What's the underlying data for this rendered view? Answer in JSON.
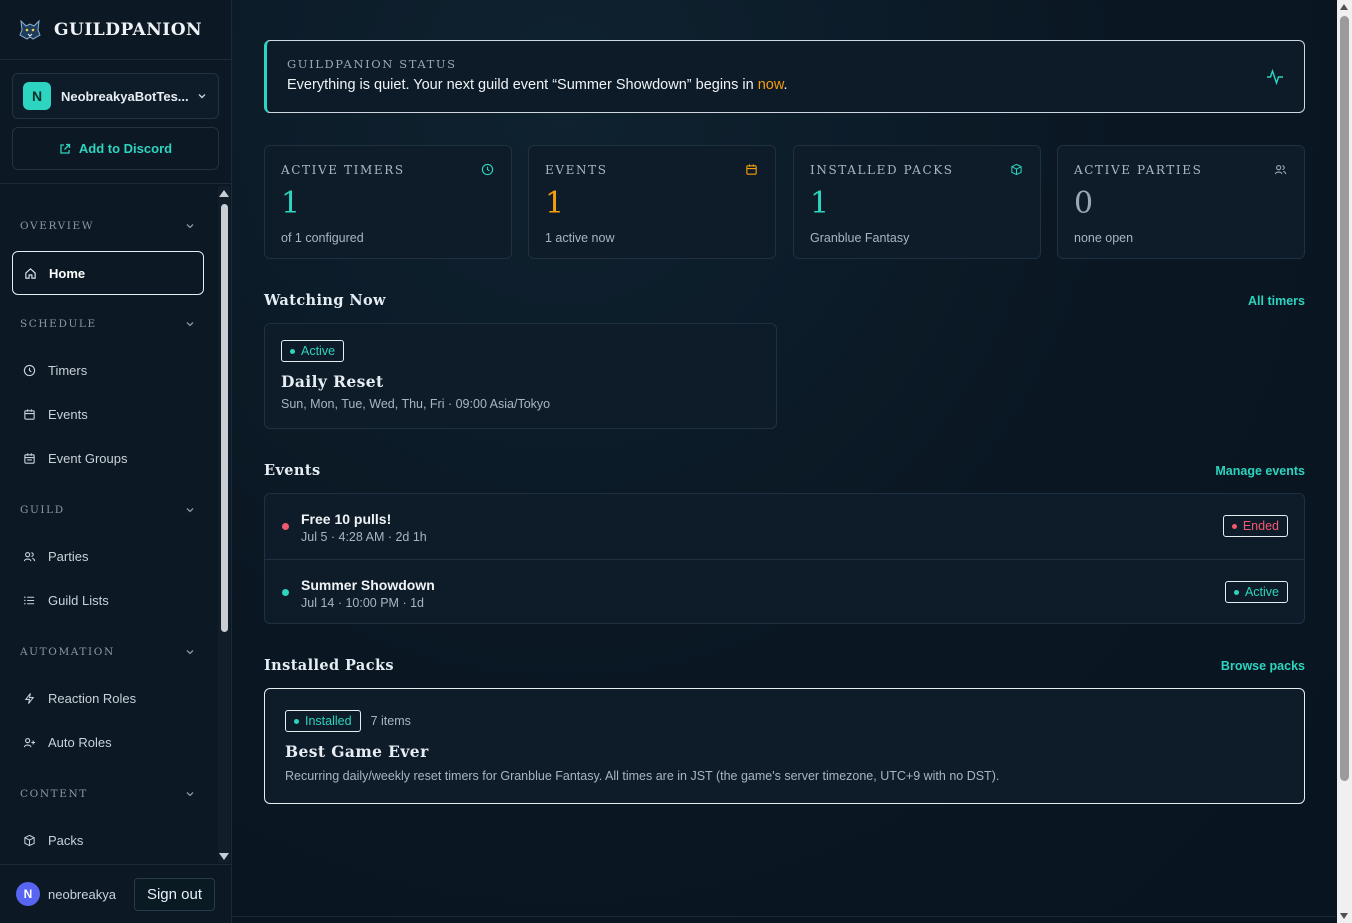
{
  "app": {
    "name": "GUILDPANION"
  },
  "server": {
    "initial": "N",
    "name": "NeobreakyaBotTes..."
  },
  "add_discord": {
    "label": "Add to Discord"
  },
  "sidebar": {
    "sections": [
      {
        "title": "OVERVIEW",
        "items": [
          {
            "label": "Home",
            "icon": "home-icon",
            "active": true
          }
        ]
      },
      {
        "title": "SCHEDULE",
        "items": [
          {
            "label": "Timers",
            "icon": "clock-icon"
          },
          {
            "label": "Events",
            "icon": "calendar-icon"
          },
          {
            "label": "Event Groups",
            "icon": "calendar-group-icon"
          }
        ]
      },
      {
        "title": "GUILD",
        "items": [
          {
            "label": "Parties",
            "icon": "users-icon"
          },
          {
            "label": "Guild Lists",
            "icon": "list-icon"
          }
        ]
      },
      {
        "title": "AUTOMATION",
        "items": [
          {
            "label": "Reaction Roles",
            "icon": "bolt-icon"
          },
          {
            "label": "Auto Roles",
            "icon": "user-plus-icon"
          }
        ]
      },
      {
        "title": "CONTENT",
        "items": [
          {
            "label": "Packs",
            "icon": "box-icon"
          }
        ]
      }
    ]
  },
  "user": {
    "initial": "N",
    "name": "neobreakya",
    "signout_label": "Sign out"
  },
  "status": {
    "title": "GUILDPANION STATUS",
    "text_before": "Everything is quiet. Your next guild event “Summer Showdown” begins in ",
    "highlight": "now",
    "text_after": "."
  },
  "stats": [
    {
      "label": "ACTIVE TIMERS",
      "value": "1",
      "sub": "of 1 configured",
      "icon": "clock-icon",
      "color": "#2dd4bf"
    },
    {
      "label": "EVENTS",
      "value": "1",
      "sub": "1 active now",
      "icon": "calendar-icon",
      "color": "#f59e0b"
    },
    {
      "label": "INSTALLED PACKS",
      "value": "1",
      "sub": "Granblue Fantasy",
      "icon": "box-icon",
      "color": "#2dd4bf"
    },
    {
      "label": "ACTIVE PARTIES",
      "value": "0",
      "sub": "none open",
      "icon": "users-icon",
      "color": "#9aa7b4"
    }
  ],
  "watching": {
    "title": "Watching Now",
    "link": "All timers",
    "card": {
      "badge": "Active",
      "title": "Daily Reset",
      "sub": "Sun, Mon, Tue, Wed, Thu, Fri · 09:00 Asia/Tokyo"
    }
  },
  "events": {
    "title": "Events",
    "link": "Manage events",
    "rows": [
      {
        "name": "Free 10 pulls!",
        "meta": "Jul 5 · 4:28 AM · 2d 1h",
        "badge": "Ended",
        "color": "#f05a6e"
      },
      {
        "name": "Summer Showdown",
        "meta": "Jul 14 · 10:00 PM · 1d",
        "badge": "Active",
        "color": "#2dd4bf"
      }
    ]
  },
  "packs": {
    "title": "Installed Packs",
    "link": "Browse packs",
    "card": {
      "badge": "Installed",
      "items": "7 items",
      "title": "Best Game Ever",
      "desc": "Recurring daily/weekly reset timers for Granblue Fantasy. All times are in JST (the game's server timezone, UTC+9 with no DST)."
    }
  },
  "colors": {
    "accent": "#2dd4bf",
    "warning": "#f59e0b",
    "danger": "#f05a6e"
  }
}
